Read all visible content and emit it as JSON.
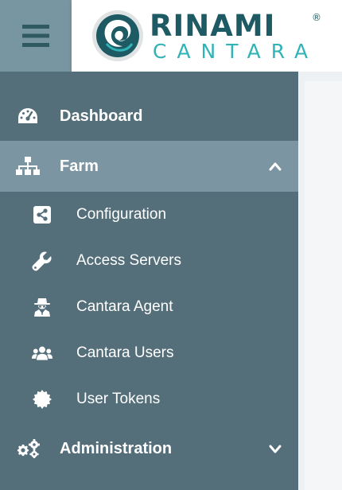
{
  "header": {
    "menu_icon": "hamburger-icon",
    "logo": {
      "top_text": "RINAMI",
      "registered": "®",
      "bottom_text": "CANTARA",
      "primary_color": "#1e5a63",
      "accent_color": "#2fb3b6"
    }
  },
  "colors": {
    "sidebar_bg": "#546e7a",
    "active_bg": "#7b96a2",
    "hamburger_bg": "#7895a2",
    "text": "#ffffff"
  },
  "sidebar": {
    "items": [
      {
        "label": "Dashboard",
        "icon": "tachometer-icon",
        "active": false,
        "expandable": false
      },
      {
        "label": "Farm",
        "icon": "sitemap-icon",
        "active": true,
        "expandable": true,
        "expanded": true,
        "children": [
          {
            "label": "Configuration",
            "icon": "share-square-icon"
          },
          {
            "label": "Access Servers",
            "icon": "wrench-icon"
          },
          {
            "label": "Cantara Agent",
            "icon": "user-secret-icon"
          },
          {
            "label": "Cantara Users",
            "icon": "users-icon"
          },
          {
            "label": "User Tokens",
            "icon": "certificate-icon"
          }
        ]
      },
      {
        "label": "Administration",
        "icon": "cogs-icon",
        "active": false,
        "expandable": true,
        "expanded": false
      }
    ]
  }
}
